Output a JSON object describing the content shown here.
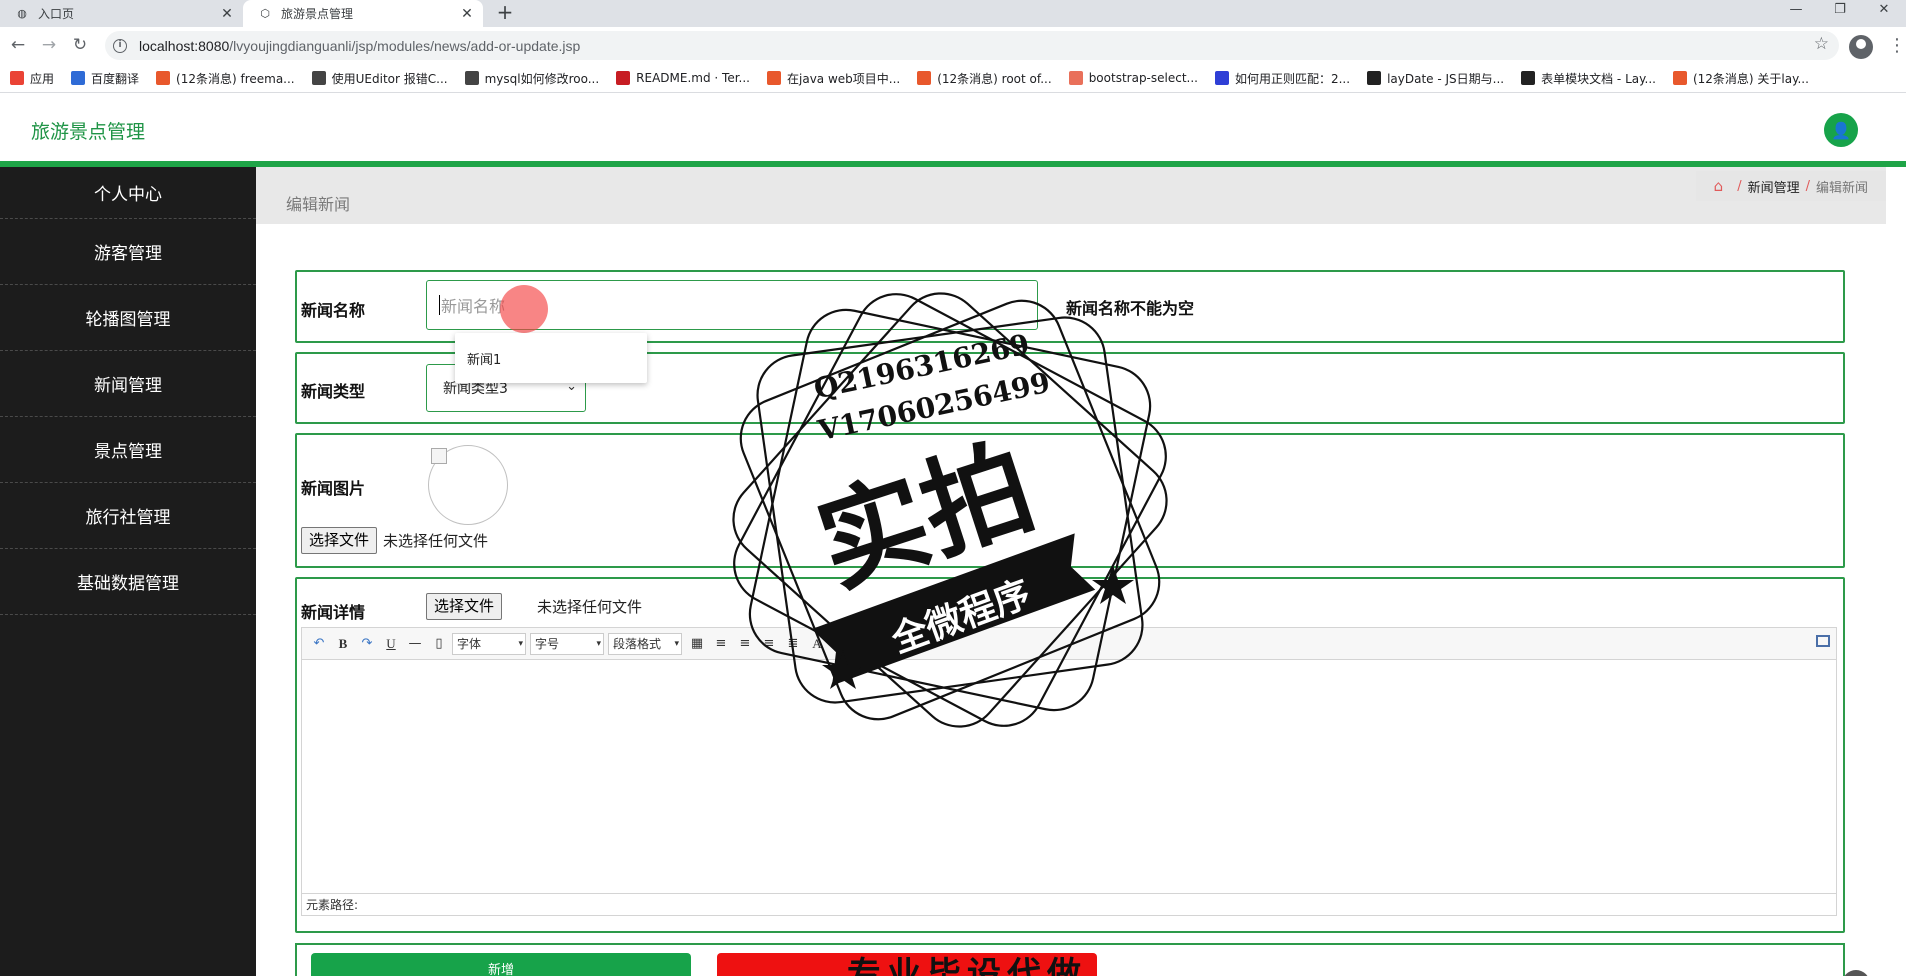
{
  "browser": {
    "tabs": [
      {
        "title": "入口页",
        "icon": "globe-icon"
      },
      {
        "title": "旅游景点管理",
        "icon": "hexagon-icon"
      }
    ],
    "url_host": "localhost:8080",
    "url_path": "/lvyoujingdianguanli/jsp/modules/news/add-or-update.jsp",
    "bookmarks": [
      {
        "label": "应用",
        "icon": "apps-grid-icon",
        "color": "#ea4335"
      },
      {
        "label": "百度翻译",
        "icon": "baidu-translate-icon",
        "color": "#2f6bd6"
      },
      {
        "label": "(12条消息) freema...",
        "icon": "csdn-icon",
        "color": "#e8582c"
      },
      {
        "label": "使用UEditor 报错C...",
        "icon": "segmentfault-icon",
        "color": "#444444"
      },
      {
        "label": "mysql如何修改roo...",
        "icon": "segmentfault-icon",
        "color": "#444444"
      },
      {
        "label": "README.md · Ter...",
        "icon": "gitee-icon",
        "color": "#c71d23"
      },
      {
        "label": "在java web项目中...",
        "icon": "csdn-icon",
        "color": "#e8582c"
      },
      {
        "label": "(12条消息) root of...",
        "icon": "csdn-icon",
        "color": "#e8582c"
      },
      {
        "label": "bootstrap-select...",
        "icon": "jianshu-icon",
        "color": "#e9705a"
      },
      {
        "label": "如何用正则匹配：2...",
        "icon": "baidu-paw-icon",
        "color": "#2f3fd6"
      },
      {
        "label": "layDate - JS日期与...",
        "icon": "layui-icon",
        "color": "#222222"
      },
      {
        "label": "表单模块文档 - Lay...",
        "icon": "layui-icon",
        "color": "#222222"
      },
      {
        "label": "(12条消息) 关于lay...",
        "icon": "csdn-icon",
        "color": "#e8582c"
      }
    ]
  },
  "app": {
    "title": "旅游景点管理",
    "accent_color": "#1fa447"
  },
  "sidebar": {
    "items": [
      {
        "label": "个人中心"
      },
      {
        "label": "游客管理"
      },
      {
        "label": "轮播图管理"
      },
      {
        "label": "新闻管理"
      },
      {
        "label": "景点管理"
      },
      {
        "label": "旅行社管理"
      },
      {
        "label": "基础数据管理"
      }
    ]
  },
  "page": {
    "title": "编辑新闻",
    "breadcrumb": [
      "新闻管理",
      "编辑新闻"
    ]
  },
  "form": {
    "name": {
      "label": "新闻名称",
      "placeholder": "新闻名称",
      "value": "",
      "error": "新闻名称不能为空",
      "autocomplete": "新闻1"
    },
    "type": {
      "label": "新闻类型",
      "selected": "新闻类型3"
    },
    "image": {
      "label": "新闻图片",
      "file_button": "选择文件",
      "file_status": "未选择任何文件"
    },
    "detail": {
      "label": "新闻详情",
      "file_button": "选择文件",
      "file_status": "未选择任何文件",
      "toolbar": {
        "font": "字体",
        "size": "字号",
        "paragraph": "段落格式",
        "bold": "B",
        "underline": "U",
        "font_color": "A"
      },
      "element_path": "元素路径:"
    },
    "submit_label": "新增"
  },
  "watermark": {
    "line1": "Q2196316269",
    "line2": "V17060256499",
    "big": "实拍",
    "ribbon": "全微程序",
    "banner_text": "专业毕设代做"
  }
}
